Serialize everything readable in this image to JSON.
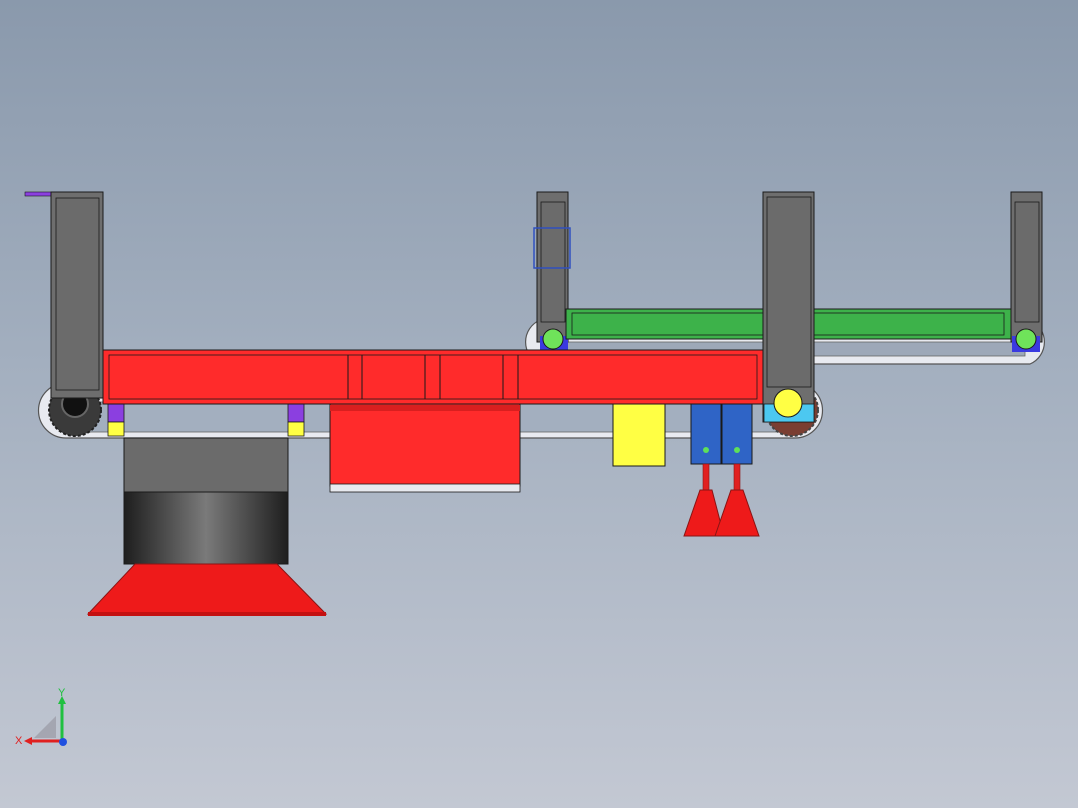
{
  "viewport": {
    "background_top": "#8a99ac",
    "background_bottom": "#c3c8d3"
  },
  "colors": {
    "red": "#ff2b2b",
    "dark_red": "#8a1414",
    "gray_post": "#6e6e6e",
    "gray_dark": "#454545",
    "outline": "#1a1a1a",
    "green_bar": "#3db24a",
    "green_roller": "#6fe35a",
    "yellow": "#ffff44",
    "purple": "#8b3fe0",
    "blue": "#2f64c6",
    "cyan": "#4cc8f0",
    "white_belt": "#e8eaf0"
  },
  "parts": {
    "left_conveyor": "left-conveyor",
    "right_conveyor": "right-conveyor",
    "main_beam": "main-red-beam",
    "green_beam": "green-upper-beam",
    "big_suction_cup": "large-suction-cup",
    "small_suction_cups": "twin-suction-cups",
    "cylinder_block": "vacuum-cylinder-block",
    "yellow_block": "yellow-sensor-block"
  },
  "triad": {
    "x_label": "X",
    "y_label": "Y",
    "x_color": "#e02020",
    "y_color": "#20c040",
    "z_color": "#2050e0"
  }
}
